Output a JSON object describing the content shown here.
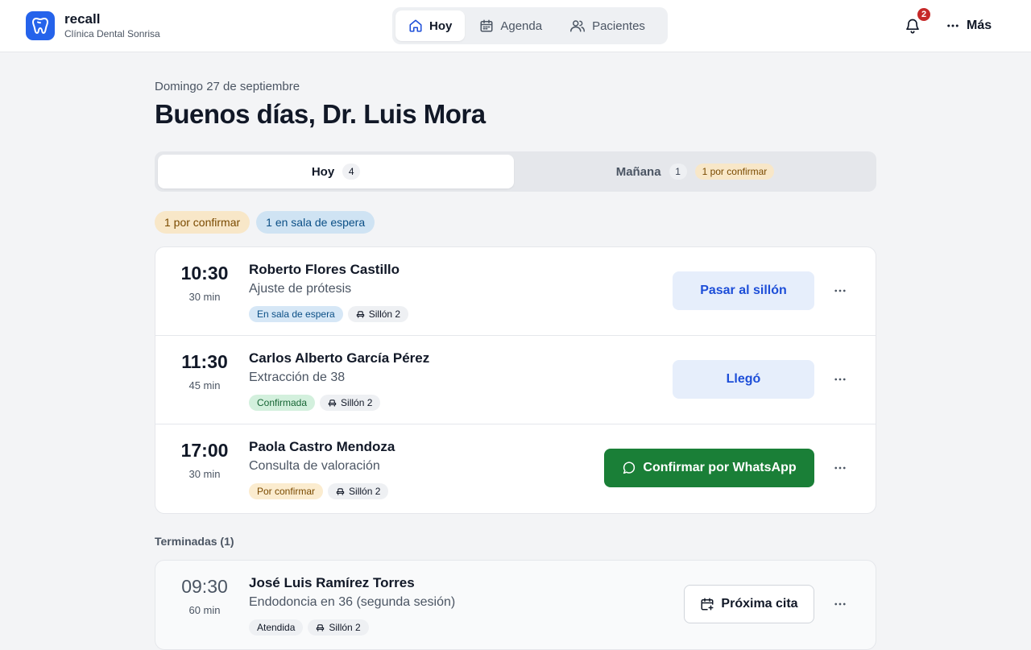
{
  "app": {
    "name": "recall",
    "clinic": "Clínica Dental Sonrisa"
  },
  "nav": [
    {
      "label": "Hoy",
      "icon": "home-icon",
      "active": true
    },
    {
      "label": "Agenda",
      "icon": "calendar-icon",
      "active": false
    },
    {
      "label": "Pacientes",
      "icon": "users-icon",
      "active": false
    }
  ],
  "header": {
    "notifications_count": "2",
    "more_label": "Más"
  },
  "page": {
    "date": "Domingo 27 de septiembre",
    "greeting": "Buenos días, Dr. Luis Mora"
  },
  "day_tabs": {
    "today": {
      "label": "Hoy",
      "count": "4"
    },
    "tomorrow": {
      "label": "Mañana",
      "count": "1",
      "badge": "1 por confirmar"
    }
  },
  "filters": [
    {
      "label": "1 por confirmar",
      "tone": "amber"
    },
    {
      "label": "1 en sala de espera",
      "tone": "blue"
    }
  ],
  "appointments": [
    {
      "time": "10:30",
      "duration": "30 min",
      "patient": "Roberto Flores Castillo",
      "procedure": "Ajuste de prótesis",
      "status": "En sala de espera",
      "status_tone": "blue",
      "chair": "Sillón 2",
      "action": "Pasar al sillón"
    },
    {
      "time": "11:30",
      "duration": "45 min",
      "patient": "Carlos Alberto García Pérez",
      "procedure": "Extracción de 38",
      "status": "Confirmada",
      "status_tone": "green",
      "chair": "Sillón 2",
      "action": "Llegó"
    },
    {
      "time": "17:00",
      "duration": "30 min",
      "patient": "Paola Castro Mendoza",
      "procedure": "Consulta de valoración",
      "status": "Por confirmar",
      "status_tone": "amber",
      "chair": "Sillón 2",
      "action": "Confirmar por WhatsApp"
    }
  ],
  "finished": {
    "label": "Terminadas (1)",
    "items": [
      {
        "time": "09:30",
        "duration": "60 min",
        "patient": "José Luis Ramírez Torres",
        "procedure": "Endodoncia en 36 (segunda sesión)",
        "status": "Atendida",
        "chair": "Sillón 2",
        "action": "Próxima cita"
      }
    ]
  },
  "colors": {
    "primary": "#2563eb",
    "whatsapp": "#1a7f37",
    "alert": "#c62828",
    "background": "#f3f4f6"
  }
}
